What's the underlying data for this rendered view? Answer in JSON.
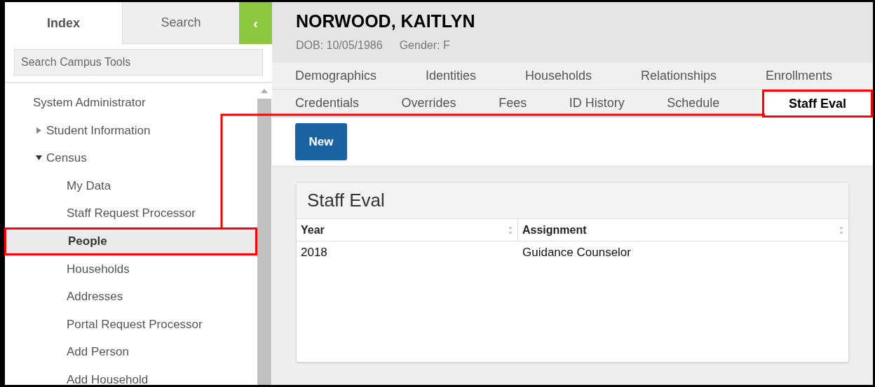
{
  "sidebar": {
    "tabs": [
      {
        "label": "Index",
        "selected": true
      },
      {
        "label": "Search",
        "selected": false
      }
    ],
    "collapse_button": {
      "label": "‹"
    },
    "search": {
      "placeholder": "Search Campus Tools"
    },
    "tree": [
      {
        "label": "System Administrator",
        "selected": false,
        "children": [
          {
            "label": "Student Information",
            "expanded": false,
            "selected": false
          },
          {
            "label": "Census",
            "expanded": true,
            "selected": false,
            "children": [
              {
                "label": "My Data",
                "selected": false
              },
              {
                "label": "Staff Request Processor",
                "selected": false
              },
              {
                "label": "People",
                "selected": true
              },
              {
                "label": "Households",
                "selected": false
              },
              {
                "label": "Addresses",
                "selected": false
              },
              {
                "label": "Portal Request Processor",
                "selected": false
              },
              {
                "label": "Add Person",
                "selected": false
              },
              {
                "label": "Add Household",
                "selected": false
              }
            ]
          }
        ]
      }
    ]
  },
  "person": {
    "name": "NORWOOD, KAITLYN",
    "dob": "DOB: 10/05/1986",
    "gender": "Gender: F"
  },
  "tab_rows": [
    {
      "tabs": [
        {
          "label": "Demographics",
          "selected": false
        },
        {
          "label": "Identities",
          "selected": false
        },
        {
          "label": "Households",
          "selected": false
        },
        {
          "label": "Relationships",
          "selected": false
        },
        {
          "label": "Enrollments",
          "selected": false
        }
      ]
    },
    {
      "tabs": [
        {
          "label": "Credentials",
          "selected": false
        },
        {
          "label": "Overrides",
          "selected": false
        },
        {
          "label": "Fees",
          "selected": false
        },
        {
          "label": "ID History",
          "selected": false
        },
        {
          "label": "Schedule",
          "selected": false
        },
        {
          "label": "Staff Eval",
          "selected": true
        }
      ]
    }
  ],
  "toolbar": {
    "button": "New"
  },
  "panel": {
    "title": "Staff Eval",
    "columns": [
      "Year",
      "Assignment"
    ],
    "rows": [
      [
        "2018",
        "Guidance Counselor"
      ]
    ]
  }
}
